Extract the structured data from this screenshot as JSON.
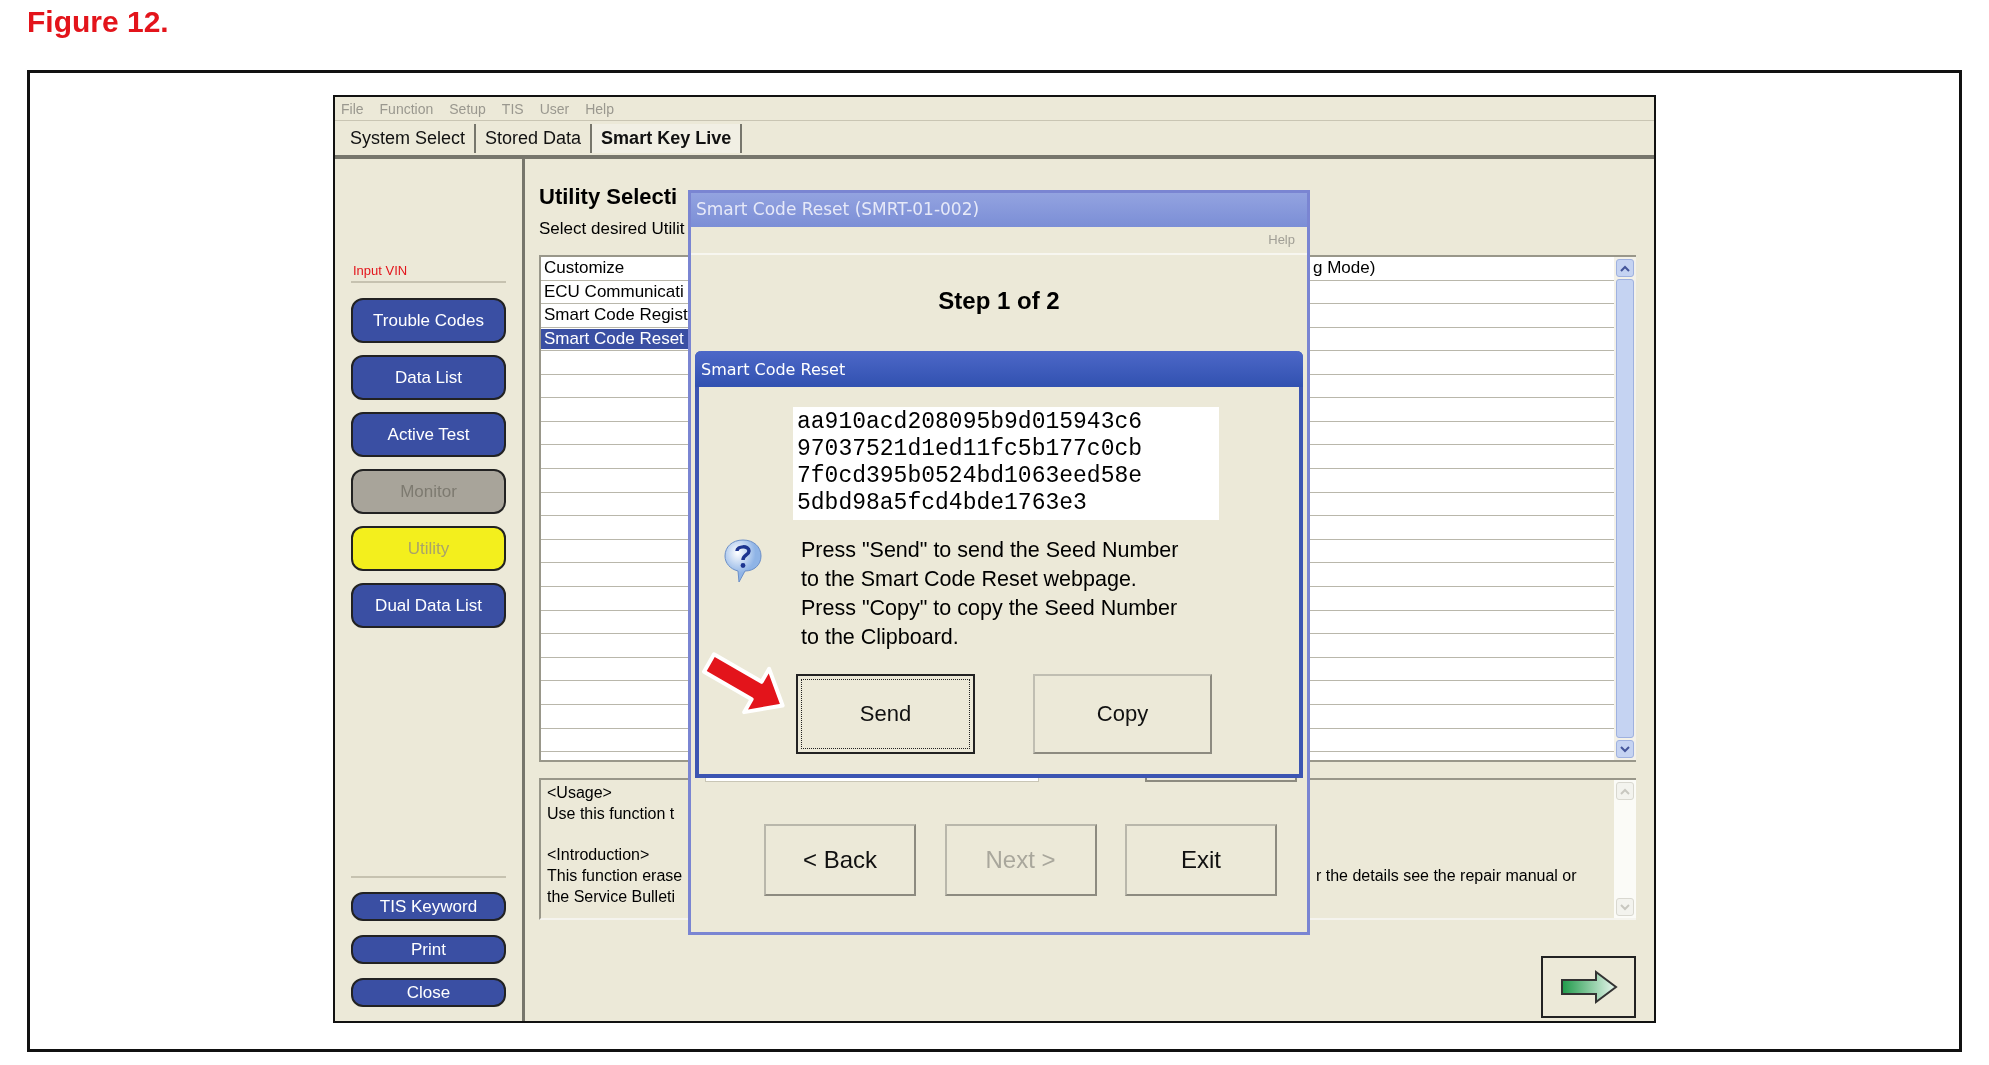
{
  "figure_title": "Figure 12.",
  "menu": [
    "File",
    "Function",
    "Setup",
    "TIS",
    "User",
    "Help"
  ],
  "tabs": [
    {
      "label": "System Select",
      "selected": false
    },
    {
      "label": "Stored Data",
      "selected": false
    },
    {
      "label": "Smart Key Live",
      "selected": true
    }
  ],
  "sidebar": {
    "vin_label": "Input VIN",
    "buttons": [
      {
        "label": "Trouble Codes",
        "selected": false,
        "disabled": false
      },
      {
        "label": "Data List",
        "selected": false,
        "disabled": false
      },
      {
        "label": "Active Test",
        "selected": false,
        "disabled": false
      },
      {
        "label": "Monitor",
        "selected": false,
        "disabled": true
      },
      {
        "label": "Utility",
        "selected": true,
        "disabled": false
      },
      {
        "label": "Dual Data List",
        "selected": false,
        "disabled": false
      }
    ],
    "bottom_buttons": [
      "TIS Keyword",
      "Print",
      "Close"
    ]
  },
  "main": {
    "title": "Utility Selecti",
    "subtitle": "Select desired Utilit",
    "list_rows": [
      {
        "left": "Customize",
        "right": "g Mode)",
        "selected": false
      },
      {
        "left": "ECU Communicati",
        "selected": false
      },
      {
        "left": "Smart Code Regist",
        "selected": false
      },
      {
        "left": "Smart Code Reset",
        "selected": true
      }
    ],
    "usage_blocks": [
      {
        "rows": [
          {
            "left": "<Usage>"
          },
          {
            "left": "Use this function t"
          }
        ]
      },
      {
        "rows": [
          {
            "left": "<Introduction>"
          },
          {
            "left": "This function erase",
            "right": "r the details see the repair manual or"
          },
          {
            "left": "the Service Bulleti"
          }
        ]
      }
    ]
  },
  "dialog": {
    "title": "Smart Code Reset (SMRT-01-002)",
    "menu": [
      "Help"
    ],
    "step": "Step 1 of 2",
    "inner": {
      "title": "Smart Code Reset",
      "seed_lines": [
        "aa910acd208095b9d015943c6",
        "97037521d1ed11fc5b177c0cb",
        "7f0cd395b0524bd1063eed58e",
        "5dbd98a5fcd4bde1763e3"
      ],
      "message_lines": [
        "Press \"Send\" to send the Seed Number",
        "to the Smart Code Reset webpage.",
        "Press \"Copy\" to copy the Seed Number",
        "to the Clipboard."
      ],
      "buttons": [
        {
          "label": "Send",
          "focused": true
        },
        {
          "label": "Copy",
          "focused": false
        }
      ]
    },
    "buttons": [
      {
        "label": "< Back",
        "disabled": false
      },
      {
        "label": "Next >",
        "disabled": true
      },
      {
        "label": "Exit",
        "disabled": false
      }
    ]
  }
}
